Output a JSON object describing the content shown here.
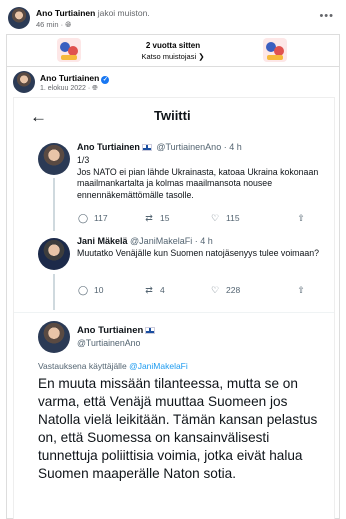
{
  "post": {
    "author": "Ano Turtiainen",
    "action": "jakoi muiston.",
    "time": "46 min",
    "time_icon": "globe-icon",
    "more_icon": "more-dots-icon"
  },
  "memory": {
    "title": "2 vuotta sitten",
    "link": "Katso muistojasi"
  },
  "shared": {
    "author": "Ano Turtiainen",
    "date": "1. elokuu 2022"
  },
  "tweet_screen": {
    "title": "Twiitti",
    "back_icon": "arrow-left-icon"
  },
  "tweets": [
    {
      "name": "Ano Turtiainen",
      "handle": "@TurtiainenAno",
      "time": "· 4 h",
      "text": "1/3\nJos NATO ei pian lähde Ukrainasta, katoaa Ukraina kokonaan maailmankartalta ja kolmas maailmansota nousee ennennäkemättömälle tasolle.",
      "replies": "117",
      "retweets": "15",
      "likes": "115"
    },
    {
      "name": "Jani Mäkelä",
      "handle": "@JaniMakelaFi",
      "time": "· 4 h",
      "text": "Muutatko Venäjälle kun Suomen natojäsenyys tulee voimaan?",
      "replies": "10",
      "retweets": "4",
      "likes": "228"
    }
  ],
  "main_tweet": {
    "name": "Ano Turtiainen",
    "handle": "@TurtiainenAno",
    "reply_prefix": "Vastauksena käyttäjälle",
    "reply_to": "@JaniMakelaFi",
    "text": "En muuta missään tilanteessa, mutta se on varma, että Venäjä muuttaa Suomeen jos Natolla vielä leikitään. Tämän kansan pelastus on, että Suomessa on kansainvälisesti tunnettuja poliittisia voimia, jotka eivät halua Suomen maaperälle Naton sotia."
  },
  "colors": {
    "twitter_blue": "#1d9bf0",
    "facebook_blue": "#1877f2",
    "muted_text": "#536471"
  }
}
